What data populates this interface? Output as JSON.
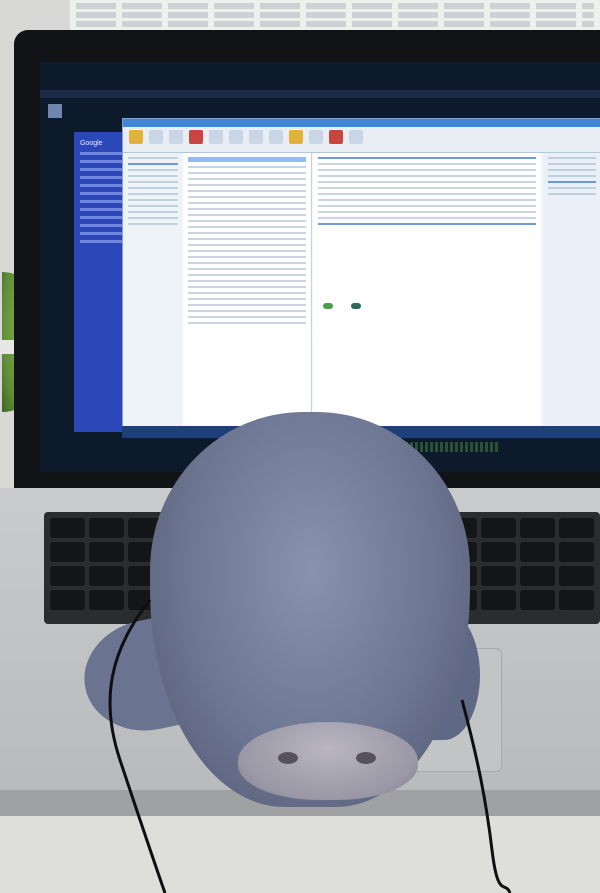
{
  "scene": {
    "objects": [
      "laptop-screen-showing-outlook-and-gmail",
      "keyboard",
      "trackpad",
      "plush-toy",
      "earphone-cable",
      "green-plush-ball",
      "background-paper"
    ]
  },
  "colors": {
    "plush": "#6d7692",
    "plush_nose": "#9a97a6",
    "screen_bg": "#0d1a2c",
    "gmail_sidebar": "#2c48b8",
    "outlook_titlebar": "#3f86d8",
    "laptop_aluminum": "#c0c2c4",
    "keyboard_keys": "#141517"
  },
  "screen": {
    "gmail_logo": "Google"
  }
}
